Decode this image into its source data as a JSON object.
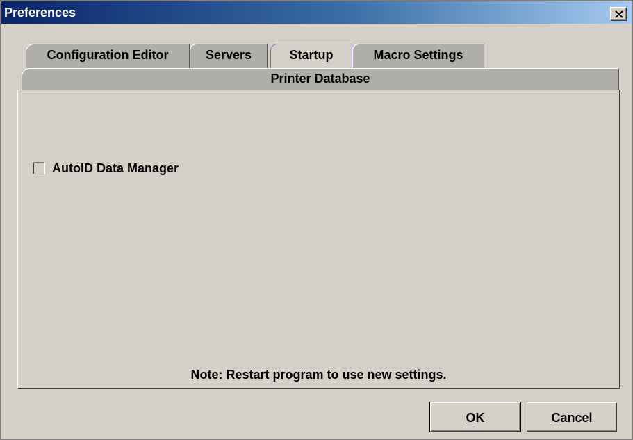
{
  "window": {
    "title": "Preferences"
  },
  "tabs": {
    "row1": [
      {
        "label": "Configuration Editor"
      },
      {
        "label": "Servers"
      },
      {
        "label": "Startup",
        "selected": true
      },
      {
        "label": "Macro Settings"
      }
    ],
    "row2": [
      {
        "label": "Printer Database"
      }
    ]
  },
  "startup": {
    "checkbox_label": "AutoID Data Manager",
    "checkbox_checked": false,
    "note": "Note: Restart program to use new settings."
  },
  "buttons": {
    "ok_mnemonic": "O",
    "ok_rest": "K",
    "cancel_mnemonic": "C",
    "cancel_rest": "ancel"
  },
  "icons": {
    "close": "close-icon"
  },
  "colors": {
    "titlebar_start": "#0a246a",
    "titlebar_end": "#a6caf0",
    "background": "#d4d0c8"
  }
}
